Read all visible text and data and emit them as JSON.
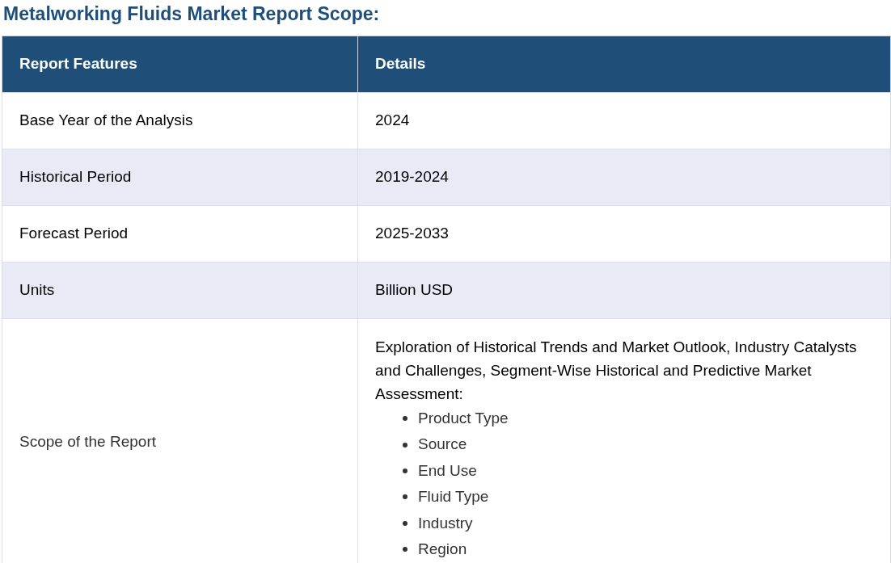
{
  "title": "Metalworking Fluids Market Report Scope:",
  "table": {
    "columns": [
      "Report Features",
      "Details"
    ],
    "rows": [
      {
        "feature": "Base Year of the Analysis",
        "details": "2024"
      },
      {
        "feature": "Historical Period",
        "details": "2019-2024"
      },
      {
        "feature": "Forecast Period",
        "details": "2025-2033"
      },
      {
        "feature": "Units",
        "details": "Billion USD"
      },
      {
        "feature": "Scope of the Report",
        "details": "Exploration of Historical Trends and Market Outlook, Industry Catalysts and Challenges, Segment-Wise Historical and Predictive Market Assessment:",
        "bullets": [
          "Product Type",
          "Source",
          "End Use",
          "Fluid Type",
          "Industry",
          "Region"
        ]
      }
    ]
  }
}
